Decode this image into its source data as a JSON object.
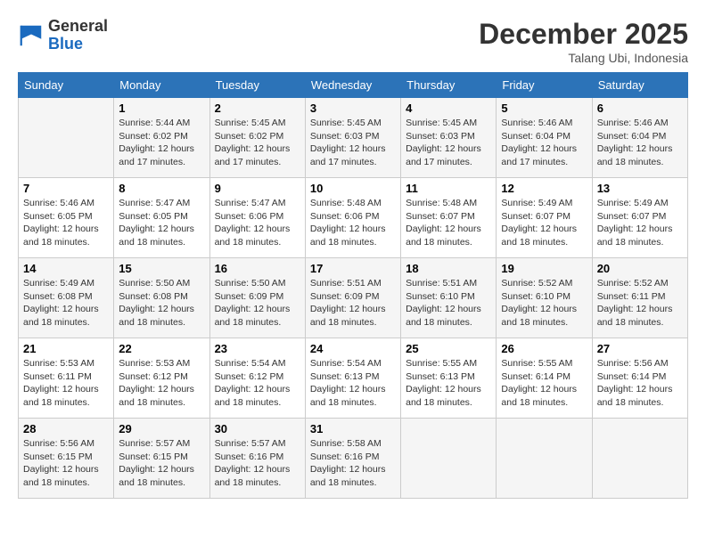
{
  "header": {
    "logo_general": "General",
    "logo_blue": "Blue",
    "month": "December 2025",
    "location": "Talang Ubi, Indonesia"
  },
  "days_of_week": [
    "Sunday",
    "Monday",
    "Tuesday",
    "Wednesday",
    "Thursday",
    "Friday",
    "Saturday"
  ],
  "weeks": [
    [
      {
        "day": "",
        "info": ""
      },
      {
        "day": "1",
        "info": "Sunrise: 5:44 AM\nSunset: 6:02 PM\nDaylight: 12 hours\nand 17 minutes."
      },
      {
        "day": "2",
        "info": "Sunrise: 5:45 AM\nSunset: 6:02 PM\nDaylight: 12 hours\nand 17 minutes."
      },
      {
        "day": "3",
        "info": "Sunrise: 5:45 AM\nSunset: 6:03 PM\nDaylight: 12 hours\nand 17 minutes."
      },
      {
        "day": "4",
        "info": "Sunrise: 5:45 AM\nSunset: 6:03 PM\nDaylight: 12 hours\nand 17 minutes."
      },
      {
        "day": "5",
        "info": "Sunrise: 5:46 AM\nSunset: 6:04 PM\nDaylight: 12 hours\nand 17 minutes."
      },
      {
        "day": "6",
        "info": "Sunrise: 5:46 AM\nSunset: 6:04 PM\nDaylight: 12 hours\nand 18 minutes."
      }
    ],
    [
      {
        "day": "7",
        "info": "Sunrise: 5:46 AM\nSunset: 6:05 PM\nDaylight: 12 hours\nand 18 minutes."
      },
      {
        "day": "8",
        "info": "Sunrise: 5:47 AM\nSunset: 6:05 PM\nDaylight: 12 hours\nand 18 minutes."
      },
      {
        "day": "9",
        "info": "Sunrise: 5:47 AM\nSunset: 6:06 PM\nDaylight: 12 hours\nand 18 minutes."
      },
      {
        "day": "10",
        "info": "Sunrise: 5:48 AM\nSunset: 6:06 PM\nDaylight: 12 hours\nand 18 minutes."
      },
      {
        "day": "11",
        "info": "Sunrise: 5:48 AM\nSunset: 6:07 PM\nDaylight: 12 hours\nand 18 minutes."
      },
      {
        "day": "12",
        "info": "Sunrise: 5:49 AM\nSunset: 6:07 PM\nDaylight: 12 hours\nand 18 minutes."
      },
      {
        "day": "13",
        "info": "Sunrise: 5:49 AM\nSunset: 6:07 PM\nDaylight: 12 hours\nand 18 minutes."
      }
    ],
    [
      {
        "day": "14",
        "info": "Sunrise: 5:49 AM\nSunset: 6:08 PM\nDaylight: 12 hours\nand 18 minutes."
      },
      {
        "day": "15",
        "info": "Sunrise: 5:50 AM\nSunset: 6:08 PM\nDaylight: 12 hours\nand 18 minutes."
      },
      {
        "day": "16",
        "info": "Sunrise: 5:50 AM\nSunset: 6:09 PM\nDaylight: 12 hours\nand 18 minutes."
      },
      {
        "day": "17",
        "info": "Sunrise: 5:51 AM\nSunset: 6:09 PM\nDaylight: 12 hours\nand 18 minutes."
      },
      {
        "day": "18",
        "info": "Sunrise: 5:51 AM\nSunset: 6:10 PM\nDaylight: 12 hours\nand 18 minutes."
      },
      {
        "day": "19",
        "info": "Sunrise: 5:52 AM\nSunset: 6:10 PM\nDaylight: 12 hours\nand 18 minutes."
      },
      {
        "day": "20",
        "info": "Sunrise: 5:52 AM\nSunset: 6:11 PM\nDaylight: 12 hours\nand 18 minutes."
      }
    ],
    [
      {
        "day": "21",
        "info": "Sunrise: 5:53 AM\nSunset: 6:11 PM\nDaylight: 12 hours\nand 18 minutes."
      },
      {
        "day": "22",
        "info": "Sunrise: 5:53 AM\nSunset: 6:12 PM\nDaylight: 12 hours\nand 18 minutes."
      },
      {
        "day": "23",
        "info": "Sunrise: 5:54 AM\nSunset: 6:12 PM\nDaylight: 12 hours\nand 18 minutes."
      },
      {
        "day": "24",
        "info": "Sunrise: 5:54 AM\nSunset: 6:13 PM\nDaylight: 12 hours\nand 18 minutes."
      },
      {
        "day": "25",
        "info": "Sunrise: 5:55 AM\nSunset: 6:13 PM\nDaylight: 12 hours\nand 18 minutes."
      },
      {
        "day": "26",
        "info": "Sunrise: 5:55 AM\nSunset: 6:14 PM\nDaylight: 12 hours\nand 18 minutes."
      },
      {
        "day": "27",
        "info": "Sunrise: 5:56 AM\nSunset: 6:14 PM\nDaylight: 12 hours\nand 18 minutes."
      }
    ],
    [
      {
        "day": "28",
        "info": "Sunrise: 5:56 AM\nSunset: 6:15 PM\nDaylight: 12 hours\nand 18 minutes."
      },
      {
        "day": "29",
        "info": "Sunrise: 5:57 AM\nSunset: 6:15 PM\nDaylight: 12 hours\nand 18 minutes."
      },
      {
        "day": "30",
        "info": "Sunrise: 5:57 AM\nSunset: 6:16 PM\nDaylight: 12 hours\nand 18 minutes."
      },
      {
        "day": "31",
        "info": "Sunrise: 5:58 AM\nSunset: 6:16 PM\nDaylight: 12 hours\nand 18 minutes."
      },
      {
        "day": "",
        "info": ""
      },
      {
        "day": "",
        "info": ""
      },
      {
        "day": "",
        "info": ""
      }
    ]
  ]
}
